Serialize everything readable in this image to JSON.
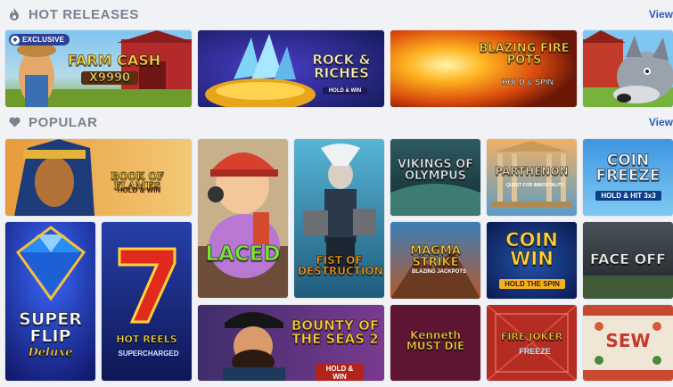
{
  "hot": {
    "title": "HOT RELEASES",
    "icon": "flame-icon",
    "view": "View"
  },
  "popular": {
    "title": "POPULAR",
    "icon": "heart-icon",
    "view": "View"
  },
  "colors": {
    "section_title": "#7a808e",
    "view_link": "#2b59b8",
    "background": "#f1f2f6",
    "exclusive_badge": "#2c3f93"
  },
  "games": {
    "farm_cash": {
      "line1": "FARM CASH",
      "line2": "x9990",
      "badge": "EXCLUSIVE"
    },
    "rock_riches": {
      "line1": "ROCK & RICHES",
      "sub": "HOLD & WIN"
    },
    "blazing": {
      "line1": "BLAZING FIRE POTS",
      "sub": "HOLD & SPIN"
    },
    "book_flames": {
      "line1": "BOOK OF FLAMES",
      "sub": "HOLD & WIN"
    },
    "laced": {
      "line1": "LACED"
    },
    "fist": {
      "line1": "FIST OF DESTRUCTION"
    },
    "vikings": {
      "line1": "VIKINGS OF OLYMPUS"
    },
    "parthenon": {
      "line1": "PARTHENON",
      "sub": "QUEST FOR IMMORTALITY"
    },
    "coin_freeze": {
      "line1": "COIN FREEZE",
      "sub": "HOLD & HIT 3x3"
    },
    "super_flip": {
      "line1": "SUPER FLIP",
      "line2": "Deluxe"
    },
    "hot_reels": {
      "line1": "HOT REELS",
      "sub": "SUPERCHARGED"
    },
    "magma": {
      "line1": "MAGMA STRIKE",
      "sub": "BLAZING JACKPOTS"
    },
    "coin_win": {
      "line1": "COIN WIN",
      "sub": "HOLD THE SPIN"
    },
    "faceoff": {
      "line1": "FACE OFF"
    },
    "bounty": {
      "line1": "BOUNTY OF THE SEAS 2",
      "sub": "HOLD & WIN"
    },
    "kenneth": {
      "line1": "Kenneth MUST DIE"
    },
    "fire_joker": {
      "line1": "FIRE JOKER",
      "sub": "FREEZE"
    },
    "sew": {
      "line1": "SEW"
    }
  }
}
